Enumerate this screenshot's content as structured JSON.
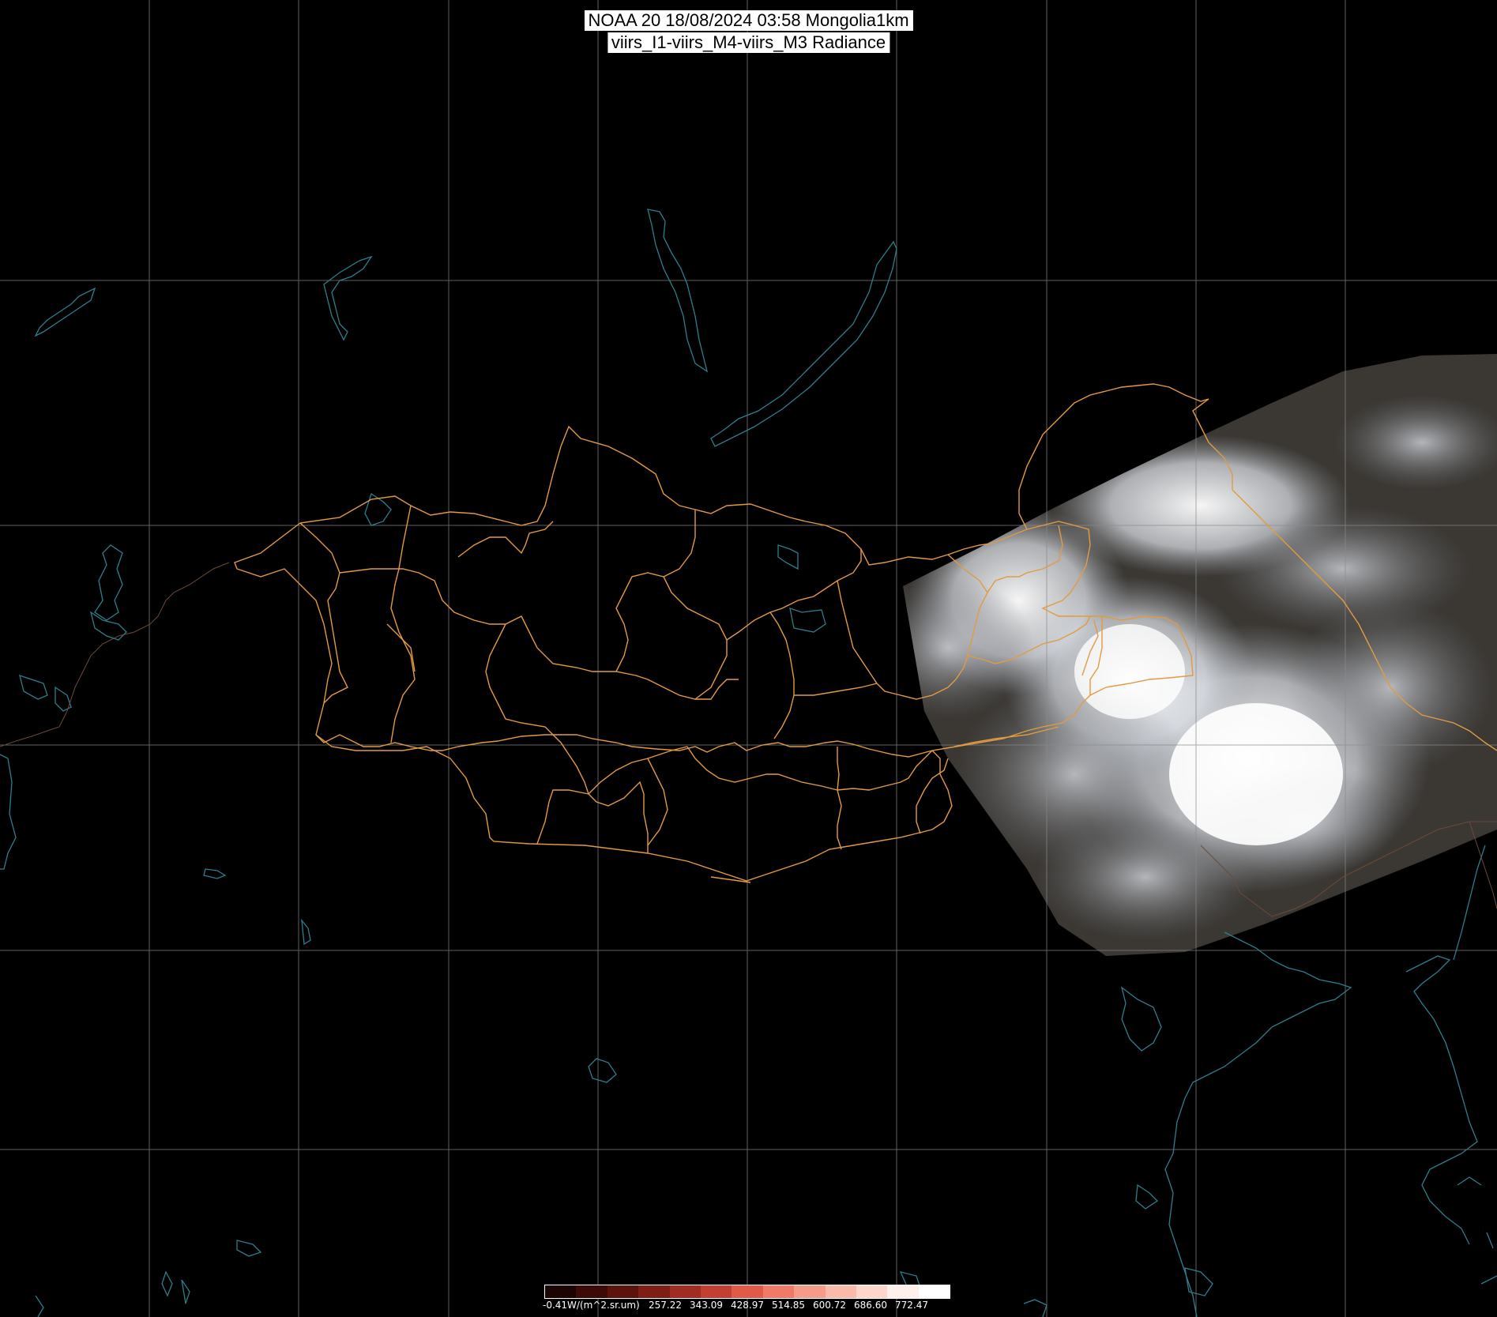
{
  "title": {
    "line1": "NOAA 20 18/08/2024 03:58 Mongolia1km",
    "line2": "viirs_I1-viirs_M4-viirs_M3 Radiance"
  },
  "colors": {
    "background": "#000000",
    "graticule": "#8a8a8a",
    "province_border": "#e29a43",
    "coastline": "#2c7f8c",
    "swath_cloud": "#e9edf3",
    "swath_ground": "#3b3834"
  },
  "colorbar": {
    "unit_label": "-0.41W/(m^2.sr.um)",
    "tick_labels": [
      "257.22",
      "343.09",
      "428.97",
      "514.85",
      "600.72",
      "686.60",
      "772.47"
    ],
    "colors": [
      "#1c0402",
      "#3c0b07",
      "#5c130d",
      "#7e1e16",
      "#a12c21",
      "#c33f31",
      "#e15a47",
      "#ef7a65",
      "#f69b88",
      "#f9baa9",
      "#fcd6ca",
      "#fef0ea",
      "#ffffff"
    ]
  }
}
